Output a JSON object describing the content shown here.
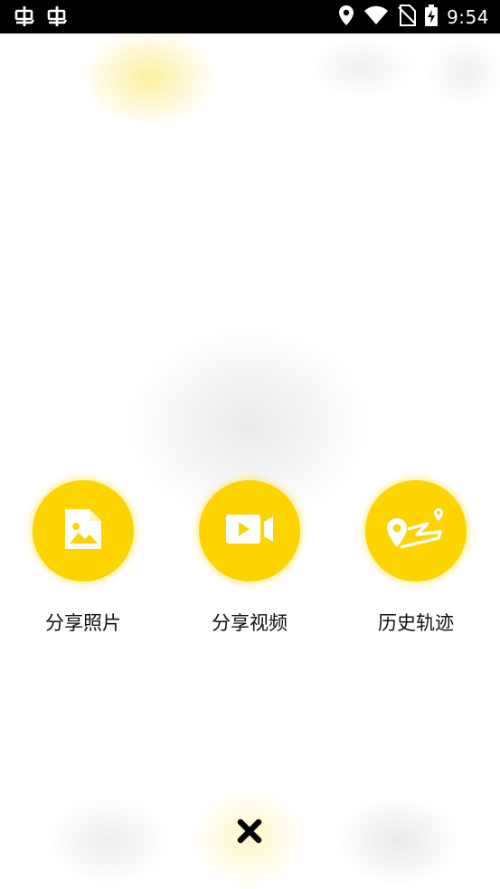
{
  "status_bar": {
    "time": "9:54",
    "icons": [
      "bug-icon",
      "bug-icon",
      "location-icon",
      "wifi-icon",
      "no-sim-icon",
      "battery-charging-icon"
    ]
  },
  "actions": [
    {
      "label": "分享照片",
      "icon": "image-file-icon"
    },
    {
      "label": "分享视频",
      "icon": "video-camera-icon"
    },
    {
      "label": "历史轨迹",
      "icon": "route-track-icon"
    }
  ],
  "close": {
    "icon": "close-icon"
  },
  "colors": {
    "accent": "#FDD400",
    "status_bar": "#000000",
    "background": "#FFFFFF"
  }
}
